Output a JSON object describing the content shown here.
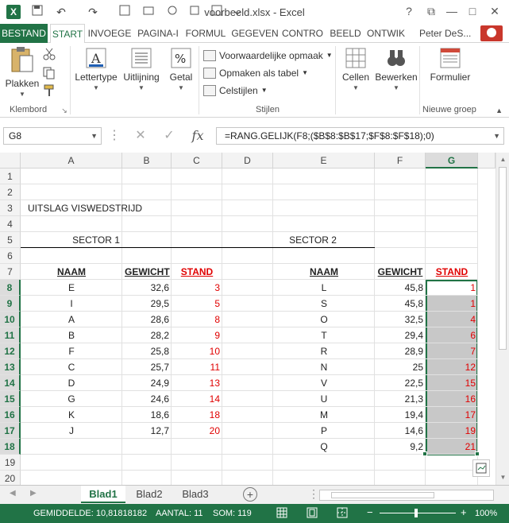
{
  "app": {
    "title": "voorbeeld.xlsx - Excel",
    "user": "Peter DeS...",
    "win_help": "?",
    "win_restore": "⧉",
    "win_min": "—",
    "win_max": "□",
    "win_close": "✕"
  },
  "qat": {
    "logo": "X",
    "undo": "↶",
    "redo": "↷"
  },
  "tabs": [
    "BESTAND",
    "START",
    "INVOEGE",
    "PAGINA-I",
    "FORMUL",
    "GEGEVEN",
    "CONTRO",
    "BEELD",
    "ONTWIK"
  ],
  "ribbon": {
    "paste": "Plakken",
    "clipboard_group": "Klembord",
    "font": "Lettertype",
    "alignment": "Uitlijning",
    "number": "Getal",
    "number_icon": "%",
    "cond_format": "Voorwaardelijke opmaak",
    "format_table": "Opmaken als tabel",
    "cell_styles": "Celstijlen",
    "styles_group": "Stijlen",
    "cells": "Cellen",
    "editing": "Bewerken",
    "form": "Formulier",
    "new_group": "Nieuwe groep"
  },
  "formula_bar": {
    "name_box": "G8",
    "cancel": "✕",
    "enter": "✓",
    "fx": "fx",
    "formula": "=RANG.GELIJK(F8;($B$8:$B$17;$F$8:$F$18);0)"
  },
  "grid": {
    "columns": [
      "A",
      "B",
      "C",
      "D",
      "E",
      "F",
      "G"
    ],
    "rows": [
      "1",
      "2",
      "3",
      "4",
      "5",
      "6",
      "7",
      "8",
      "9",
      "10",
      "11",
      "12",
      "13",
      "14",
      "15",
      "16",
      "17",
      "18",
      "19",
      "20"
    ],
    "title": "UITSLAG VISWEDSTRIJD",
    "sector1": "SECTOR 1",
    "sector2": "SECTOR 2",
    "hdr_naam": "NAAM",
    "hdr_gewicht": "GEWICHT",
    "hdr_stand": "STAND",
    "sector1_rows": [
      {
        "naam": "E",
        "gewicht": "32,6",
        "stand": "3"
      },
      {
        "naam": "I",
        "gewicht": "29,5",
        "stand": "5"
      },
      {
        "naam": "A",
        "gewicht": "28,6",
        "stand": "8"
      },
      {
        "naam": "B",
        "gewicht": "28,2",
        "stand": "9"
      },
      {
        "naam": "F",
        "gewicht": "25,8",
        "stand": "10"
      },
      {
        "naam": "C",
        "gewicht": "25,7",
        "stand": "11"
      },
      {
        "naam": "D",
        "gewicht": "24,9",
        "stand": "13"
      },
      {
        "naam": "G",
        "gewicht": "24,6",
        "stand": "14"
      },
      {
        "naam": "K",
        "gewicht": "18,6",
        "stand": "18"
      },
      {
        "naam": "J",
        "gewicht": "12,7",
        "stand": "20"
      }
    ],
    "sector2_rows": [
      {
        "naam": "L",
        "gewicht": "45,8",
        "stand": "1"
      },
      {
        "naam": "S",
        "gewicht": "45,8",
        "stand": "1"
      },
      {
        "naam": "O",
        "gewicht": "32,5",
        "stand": "4"
      },
      {
        "naam": "T",
        "gewicht": "29,4",
        "stand": "6"
      },
      {
        "naam": "R",
        "gewicht": "28,9",
        "stand": "7"
      },
      {
        "naam": "N",
        "gewicht": "25",
        "stand": "12"
      },
      {
        "naam": "V",
        "gewicht": "22,5",
        "stand": "15"
      },
      {
        "naam": "U",
        "gewicht": "21,3",
        "stand": "16"
      },
      {
        "naam": "M",
        "gewicht": "19,4",
        "stand": "17"
      },
      {
        "naam": "P",
        "gewicht": "14,6",
        "stand": "19"
      },
      {
        "naam": "Q",
        "gewicht": "9,2",
        "stand": "21"
      }
    ]
  },
  "sheets": [
    "Blad1",
    "Blad2",
    "Blad3"
  ],
  "sheet_nav": {
    "prev": "◀",
    "next": "▶",
    "add": "+"
  },
  "status": {
    "average": "GEMIDDELDE: 10,81818182",
    "count": "AANTAL: 11",
    "sum": "SOM: 119",
    "zoom_minus": "−",
    "zoom_plus": "+",
    "zoom": "100%"
  },
  "colors": {
    "accent": "#217346",
    "red_text": "#e00000",
    "selection": "#c8c8c8"
  }
}
